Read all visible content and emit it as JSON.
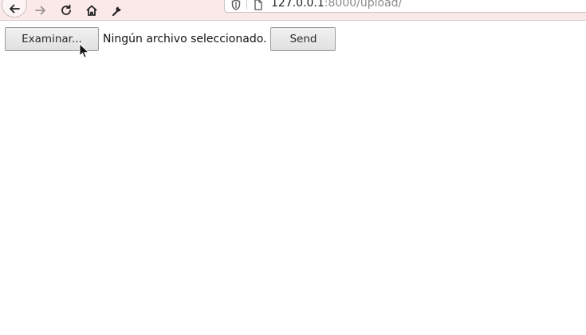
{
  "browser": {
    "url_host": "127.0.0.1",
    "url_rest": ":8000/upload/"
  },
  "form": {
    "browse_label": "Examinar...",
    "file_status": "Ningún archivo seleccionado.",
    "send_label": "Send"
  },
  "icons": {
    "back": "back-arrow-icon",
    "forward": "forward-arrow-icon",
    "reload": "reload-icon",
    "home": "home-icon",
    "tools": "wrench-icon",
    "shield": "shield-icon",
    "page": "page-icon",
    "cursor": "mouse-pointer-icon"
  }
}
